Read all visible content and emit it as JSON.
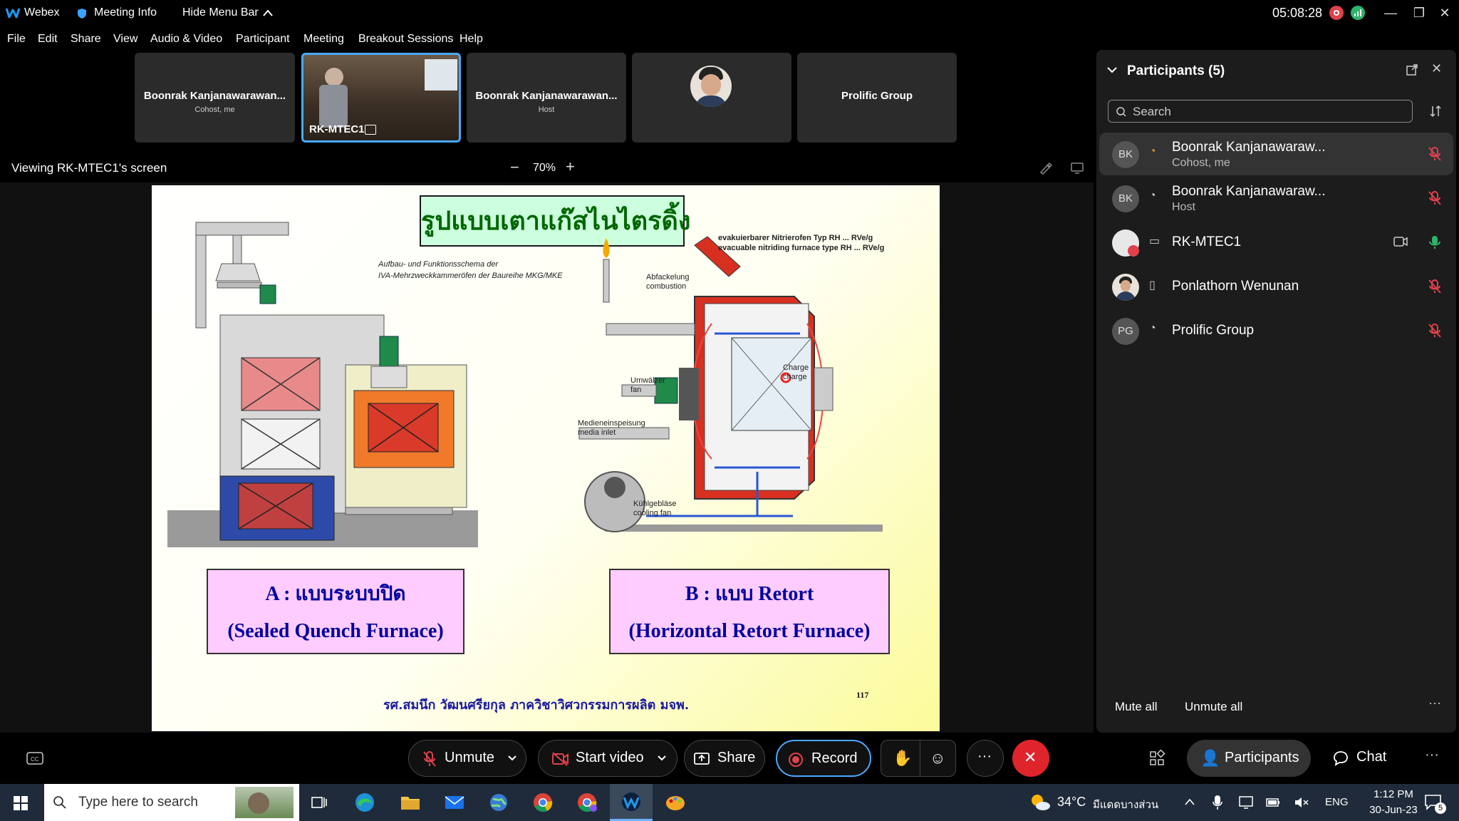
{
  "titlebar": {
    "app": "Webex",
    "meeting_info": "Meeting Info",
    "hide_menu": "Hide Menu Bar",
    "timer": "05:08:28"
  },
  "menu": [
    "File",
    "Edit",
    "Share",
    "View",
    "Audio & Video",
    "Participant",
    "Meeting",
    "Breakout Sessions",
    "Help"
  ],
  "tiles": [
    {
      "name": "Boonrak Kanjanawarawan...",
      "role": "Cohost, me"
    },
    {
      "name": "RK-MTEC1",
      "role": ""
    },
    {
      "name": "Boonrak Kanjanawarawan...",
      "role": "Host"
    },
    {
      "name": "",
      "role": ""
    },
    {
      "name": "Prolific Group",
      "role": ""
    }
  ],
  "share": {
    "viewing": "Viewing RK-MTEC1's screen",
    "zoom": "70%",
    "zoom_out": "−",
    "zoom_in": "+"
  },
  "slide": {
    "title": "รูปแบบเตาแก๊สไนไตรดิ้ง",
    "caption_a_1": "A : แบบระบบปิด",
    "caption_a_2": "(Sealed Quench Furnace)",
    "caption_b_1": "B : แบบ Retort",
    "caption_b_2": "(Horizontal Retort Furnace)",
    "footer": "รศ.สมนึก  วัฒนศรียกุล ภาควิชาวิศวกรรมการผลิต มจพ.",
    "page": "117",
    "lbl_a_1": "Aufbau- und Funktionsschema der",
    "lbl_a_2": "IVA-Mehrzweckkammeröfen der Baureihe MKG/MKE",
    "lbl_b_1": "evakuierbarer Nitrierofen Typ RH ... RVe/g",
    "lbl_b_2": "evacuable nitriding furnace type RH ... RVe/g",
    "lbl_abf": "Abfackelung",
    "lbl_comb": "combustion",
    "lbl_umw": "Umwälzer",
    "lbl_fan": "fan",
    "lbl_med": "Medieneinspeisung",
    "lbl_media": "media inlet",
    "lbl_charge": "Charge",
    "lbl_charge2": "charge",
    "lbl_kuhl": "Kühlgebläse",
    "lbl_cool": "cooling fan"
  },
  "participants": {
    "title": "Participants (5)",
    "search_placeholder": "Search",
    "list": [
      {
        "initials": "BK",
        "name": "Boonrak Kanjanawaraw...",
        "role": "Cohost, me",
        "mic": "muted"
      },
      {
        "initials": "BK",
        "name": "Boonrak Kanjanawaraw...",
        "role": "Host",
        "mic": "muted"
      },
      {
        "initials": "",
        "name": "RK-MTEC1",
        "role": "",
        "mic": "active"
      },
      {
        "initials": "",
        "name": "Ponlathorn Wenunan",
        "role": "",
        "mic": "muted"
      },
      {
        "initials": "PG",
        "name": "Prolific Group",
        "role": "",
        "mic": "muted"
      }
    ],
    "mute_all": "Mute all",
    "unmute_all": "Unmute all"
  },
  "controls": {
    "unmute": "Unmute",
    "start_video": "Start video",
    "share": "Share",
    "record": "Record",
    "participants": "Participants",
    "chat": "Chat"
  },
  "taskbar": {
    "search": "Type here to search",
    "temp": "34°C",
    "weather": "มีแดดบางส่วน",
    "lang": "ENG",
    "time": "1:12 PM",
    "date": "30-Jun-23",
    "notif": "5"
  },
  "colors": {
    "accent": "#1d9bf0",
    "leave": "#e0242b",
    "mic_muted": "#e0414b",
    "mic_active": "#2fb36b"
  }
}
